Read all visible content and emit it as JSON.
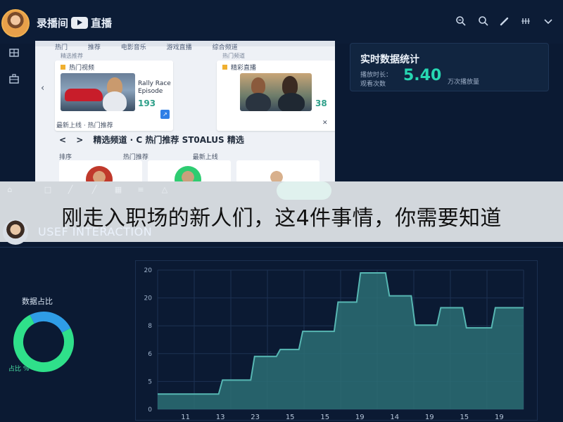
{
  "header": {
    "app_title": "录播间 ▶ 直播",
    "app_title_left": "录播间",
    "app_title_right": "直播",
    "icons": [
      "search-plus-icon",
      "search-icon",
      "edit-icon",
      "grid-icon",
      "chevron-down-icon"
    ]
  },
  "rail": {
    "icons": [
      "home-icon",
      "briefcase-icon"
    ]
  },
  "browser_panel": {
    "tabs": [
      "热门",
      "推荐",
      "电影音乐",
      "游戏直播",
      "综合频道"
    ],
    "cards": [
      {
        "section": "精选推荐",
        "label": "热门视频",
        "caption_line1": "Rally Race",
        "caption_line2": "Episode",
        "number": "193"
      },
      {
        "section": "热门频道",
        "label": "精彩直播",
        "caption_line1": "",
        "caption_line2": "",
        "number": "38"
      }
    ],
    "sub_header": "最新上线 · 热门推荐",
    "nav": {
      "back": "<",
      "forward": ">",
      "title": "精选频道 · C 热门推荐   ST0ALUS 精选"
    },
    "sort_labels": [
      "排序",
      "热门推荐",
      "最新上线"
    ]
  },
  "stats": {
    "title": "实时数据统计",
    "sub_label_1": "播放时长：",
    "sub_label_2": "观看次数",
    "value": "5.40",
    "note": "万次播放量"
  },
  "banner": {
    "text": "刚走入职场的新人们，这4件事情，你需要知道"
  },
  "section": {
    "title": "USEF INTERACTION"
  },
  "donut": {
    "title": "数据占比",
    "note": "占比 %",
    "segments": [
      {
        "value": 75,
        "color": "#2fe08a"
      },
      {
        "value": 25,
        "color": "#2f9de6"
      }
    ]
  },
  "chart_data": {
    "type": "area",
    "x_tick_labels": [
      "11",
      "13",
      "23",
      "15",
      "15",
      "19",
      "14",
      "19",
      "15",
      "19"
    ],
    "y_tick_labels": [
      "0",
      "5",
      "6",
      "8",
      "20",
      "20"
    ],
    "ylim": [
      0,
      20
    ],
    "y_ticks": [
      0,
      4,
      8,
      12,
      16,
      20
    ],
    "steps": [
      {
        "x_start": 0.0,
        "x_end": 1.9,
        "y": 2.2
      },
      {
        "x_start": 1.9,
        "x_end": 2.9,
        "y": 4.2
      },
      {
        "x_start": 2.9,
        "x_end": 3.7,
        "y": 7.6
      },
      {
        "x_start": 3.7,
        "x_end": 4.4,
        "y": 8.6
      },
      {
        "x_start": 4.4,
        "x_end": 5.5,
        "y": 11.2
      },
      {
        "x_start": 5.5,
        "x_end": 6.2,
        "y": 15.4
      },
      {
        "x_start": 6.2,
        "x_end": 7.1,
        "y": 19.6
      },
      {
        "x_start": 7.1,
        "x_end": 7.9,
        "y": 16.3
      },
      {
        "x_start": 7.9,
        "x_end": 8.7,
        "y": 12.1
      },
      {
        "x_start": 8.7,
        "x_end": 9.5,
        "y": 14.6
      },
      {
        "x_start": 9.5,
        "x_end": 10.4,
        "y": 11.7
      },
      {
        "x_start": 10.4,
        "x_end": 11.4,
        "y": 14.6
      }
    ],
    "x_range": [
      0,
      11.4
    ],
    "grid": true,
    "colors": {
      "fill": "#2c6f74",
      "line": "#57b7b3"
    }
  },
  "colors": {
    "background": "#0b1a33",
    "accent": "#27d7b2",
    "banner": "#eef1f4"
  }
}
